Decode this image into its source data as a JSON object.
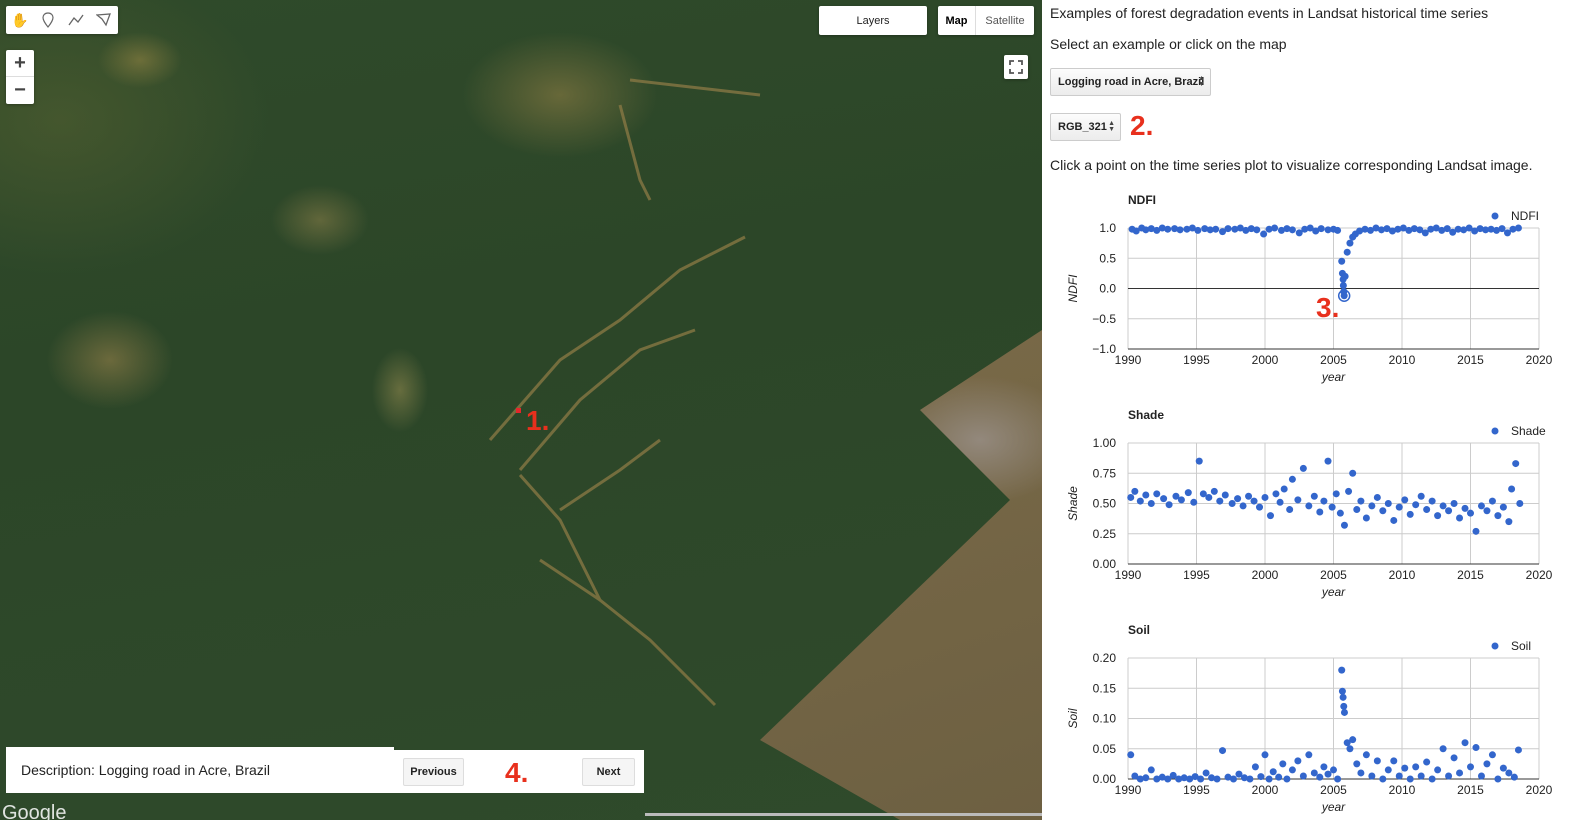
{
  "map": {
    "toolbar_icons": [
      "hand-icon",
      "pin-icon",
      "line-icon",
      "polygon-icon"
    ],
    "zoom_in": "+",
    "zoom_out": "−",
    "layers_label": "Layers",
    "map_type_map": "Map",
    "map_type_satellite": "Satellite",
    "google": "Google",
    "description": "Description: Logging road in Acre, Brazil",
    "previous_label": "Previous",
    "next_label": "Next",
    "annotations": {
      "a1": "1.",
      "a2": "2.",
      "a3": "3.",
      "a4": "4."
    },
    "annotation_color": "#e8301d"
  },
  "panel": {
    "title": "Examples of forest degradation events in Landsat historical time series",
    "select_prompt": "Select an example or click on the map",
    "example_select": "Logging road in Acre, Brazil",
    "band_select": "RGB_321",
    "click_prompt": "Click a point on the time series plot to visualize corresponding Landsat image."
  },
  "chart_data": [
    {
      "type": "scatter",
      "title": "NDFI",
      "xlabel": "year",
      "ylabel": "NDFI",
      "legend": "NDFI",
      "legend_position": "top-right",
      "xlim": [
        1990,
        2020
      ],
      "ylim": [
        -1.0,
        1.0
      ],
      "xticks": [
        1990,
        1995,
        2000,
        2005,
        2010,
        2015,
        2020
      ],
      "yticks": [
        -1.0,
        -0.5,
        0.0,
        0.5,
        1.0
      ],
      "ytick_labels": [
        "−1.0",
        "−0.5",
        "0.0",
        "0.5",
        "1.0"
      ],
      "zero_line": true,
      "color": "#3366cc",
      "points": [
        [
          1990.3,
          0.98
        ],
        [
          1990.6,
          0.95
        ],
        [
          1991.0,
          1.0
        ],
        [
          1991.3,
          0.97
        ],
        [
          1991.7,
          0.99
        ],
        [
          1992.1,
          0.96
        ],
        [
          1992.5,
          1.0
        ],
        [
          1992.9,
          0.98
        ],
        [
          1993.4,
          0.99
        ],
        [
          1993.8,
          0.97
        ],
        [
          1994.3,
          0.98
        ],
        [
          1994.7,
          1.0
        ],
        [
          1995.1,
          0.96
        ],
        [
          1995.6,
          0.99
        ],
        [
          1996.0,
          0.97
        ],
        [
          1996.4,
          0.98
        ],
        [
          1996.9,
          0.94
        ],
        [
          1997.3,
          0.99
        ],
        [
          1997.8,
          0.98
        ],
        [
          1998.2,
          1.0
        ],
        [
          1998.6,
          0.96
        ],
        [
          1999.0,
          0.99
        ],
        [
          1999.4,
          0.97
        ],
        [
          1999.9,
          0.9
        ],
        [
          2000.3,
          0.98
        ],
        [
          2000.7,
          1.0
        ],
        [
          2001.2,
          0.96
        ],
        [
          2001.6,
          0.99
        ],
        [
          2002.0,
          0.97
        ],
        [
          2002.5,
          0.92
        ],
        [
          2002.9,
          0.98
        ],
        [
          2003.3,
          1.0
        ],
        [
          2003.7,
          0.95
        ],
        [
          2004.1,
          0.99
        ],
        [
          2004.6,
          0.97
        ],
        [
          2005.0,
          0.98
        ],
        [
          2005.3,
          0.96
        ],
        [
          2005.6,
          0.45
        ],
        [
          2005.65,
          0.25
        ],
        [
          2005.7,
          0.15
        ],
        [
          2005.72,
          0.05
        ],
        [
          2005.75,
          -0.05
        ],
        [
          2005.78,
          -0.12
        ],
        [
          2005.85,
          0.2
        ],
        [
          2006.0,
          0.6
        ],
        [
          2006.2,
          0.75
        ],
        [
          2006.4,
          0.85
        ],
        [
          2006.6,
          0.9
        ],
        [
          2006.9,
          0.95
        ],
        [
          2007.3,
          0.98
        ],
        [
          2007.7,
          0.96
        ],
        [
          2008.1,
          1.0
        ],
        [
          2008.5,
          0.97
        ],
        [
          2008.9,
          0.99
        ],
        [
          2009.3,
          0.95
        ],
        [
          2009.7,
          0.98
        ],
        [
          2010.1,
          1.0
        ],
        [
          2010.5,
          0.96
        ],
        [
          2010.9,
          0.99
        ],
        [
          2011.3,
          0.97
        ],
        [
          2011.7,
          0.92
        ],
        [
          2012.1,
          0.98
        ],
        [
          2012.5,
          1.0
        ],
        [
          2012.9,
          0.96
        ],
        [
          2013.3,
          0.99
        ],
        [
          2013.7,
          0.93
        ],
        [
          2014.1,
          0.98
        ],
        [
          2014.5,
          0.97
        ],
        [
          2014.9,
          1.0
        ],
        [
          2015.3,
          0.95
        ],
        [
          2015.7,
          0.99
        ],
        [
          2016.1,
          0.97
        ],
        [
          2016.5,
          0.98
        ],
        [
          2016.9,
          0.96
        ],
        [
          2017.3,
          0.99
        ],
        [
          2017.7,
          0.92
        ],
        [
          2018.1,
          0.98
        ],
        [
          2018.5,
          1.0
        ]
      ],
      "selected_point": [
        2005.78,
        -0.12
      ]
    },
    {
      "type": "scatter",
      "title": "Shade",
      "xlabel": "year",
      "ylabel": "Shade",
      "legend": "Shade",
      "legend_position": "top-right",
      "xlim": [
        1990,
        2020
      ],
      "ylim": [
        0.0,
        1.0
      ],
      "xticks": [
        1990,
        1995,
        2000,
        2005,
        2010,
        2015,
        2020
      ],
      "yticks": [
        0.0,
        0.25,
        0.5,
        0.75,
        1.0
      ],
      "ytick_labels": [
        "0.00",
        "0.25",
        "0.50",
        "0.75",
        "1.00"
      ],
      "color": "#3366cc",
      "points": [
        [
          1990.2,
          0.55
        ],
        [
          1990.5,
          0.6
        ],
        [
          1990.9,
          0.52
        ],
        [
          1991.3,
          0.57
        ],
        [
          1991.7,
          0.5
        ],
        [
          1992.1,
          0.58
        ],
        [
          1992.6,
          0.54
        ],
        [
          1993.0,
          0.49
        ],
        [
          1993.5,
          0.56
        ],
        [
          1993.9,
          0.53
        ],
        [
          1994.4,
          0.59
        ],
        [
          1994.8,
          0.51
        ],
        [
          1995.2,
          0.85
        ],
        [
          1995.5,
          0.58
        ],
        [
          1995.9,
          0.55
        ],
        [
          1996.3,
          0.6
        ],
        [
          1996.7,
          0.52
        ],
        [
          1997.1,
          0.57
        ],
        [
          1997.6,
          0.5
        ],
        [
          1998.0,
          0.54
        ],
        [
          1998.4,
          0.48
        ],
        [
          1998.8,
          0.56
        ],
        [
          1999.2,
          0.52
        ],
        [
          1999.6,
          0.47
        ],
        [
          2000.0,
          0.55
        ],
        [
          2000.4,
          0.4
        ],
        [
          2000.8,
          0.58
        ],
        [
          2001.1,
          0.51
        ],
        [
          2001.4,
          0.62
        ],
        [
          2001.8,
          0.45
        ],
        [
          2002.0,
          0.7
        ],
        [
          2002.4,
          0.53
        ],
        [
          2002.8,
          0.79
        ],
        [
          2003.2,
          0.48
        ],
        [
          2003.6,
          0.56
        ],
        [
          2004.0,
          0.43
        ],
        [
          2004.3,
          0.52
        ],
        [
          2004.6,
          0.85
        ],
        [
          2004.9,
          0.47
        ],
        [
          2005.2,
          0.58
        ],
        [
          2005.5,
          0.42
        ],
        [
          2005.8,
          0.32
        ],
        [
          2006.1,
          0.6
        ],
        [
          2006.4,
          0.75
        ],
        [
          2006.7,
          0.45
        ],
        [
          2007.0,
          0.52
        ],
        [
          2007.4,
          0.38
        ],
        [
          2007.8,
          0.48
        ],
        [
          2008.2,
          0.55
        ],
        [
          2008.6,
          0.44
        ],
        [
          2009.0,
          0.5
        ],
        [
          2009.4,
          0.36
        ],
        [
          2009.8,
          0.47
        ],
        [
          2010.2,
          0.53
        ],
        [
          2010.6,
          0.41
        ],
        [
          2011.0,
          0.49
        ],
        [
          2011.4,
          0.56
        ],
        [
          2011.8,
          0.45
        ],
        [
          2012.2,
          0.52
        ],
        [
          2012.6,
          0.4
        ],
        [
          2013.0,
          0.48
        ],
        [
          2013.4,
          0.44
        ],
        [
          2013.8,
          0.5
        ],
        [
          2014.2,
          0.38
        ],
        [
          2014.6,
          0.46
        ],
        [
          2015.0,
          0.42
        ],
        [
          2015.4,
          0.27
        ],
        [
          2015.8,
          0.48
        ],
        [
          2016.2,
          0.44
        ],
        [
          2016.6,
          0.52
        ],
        [
          2017.0,
          0.4
        ],
        [
          2017.4,
          0.47
        ],
        [
          2017.8,
          0.35
        ],
        [
          2018.0,
          0.62
        ],
        [
          2018.3,
          0.83
        ],
        [
          2018.6,
          0.5
        ]
      ]
    },
    {
      "type": "scatter",
      "title": "Soil",
      "xlabel": "year",
      "ylabel": "Soil",
      "legend": "Soil",
      "legend_position": "top-right",
      "xlim": [
        1990,
        2020
      ],
      "ylim": [
        0.0,
        0.2
      ],
      "xticks": [
        1990,
        1995,
        2000,
        2005,
        2010,
        2015,
        2020
      ],
      "yticks": [
        0.0,
        0.05,
        0.1,
        0.15,
        0.2
      ],
      "ytick_labels": [
        "0.00",
        "0.05",
        "0.10",
        "0.15",
        "0.20"
      ],
      "color": "#3366cc",
      "points": [
        [
          1990.2,
          0.04
        ],
        [
          1990.5,
          0.005
        ],
        [
          1990.9,
          0.0
        ],
        [
          1991.3,
          0.002
        ],
        [
          1991.7,
          0.015
        ],
        [
          1992.1,
          0.0
        ],
        [
          1992.5,
          0.003
        ],
        [
          1992.9,
          0.0
        ],
        [
          1993.3,
          0.006
        ],
        [
          1993.7,
          0.0
        ],
        [
          1994.1,
          0.002
        ],
        [
          1994.5,
          0.0
        ],
        [
          1994.9,
          0.004
        ],
        [
          1995.3,
          0.0
        ],
        [
          1995.7,
          0.01
        ],
        [
          1996.1,
          0.002
        ],
        [
          1996.5,
          0.0
        ],
        [
          1996.9,
          0.047
        ],
        [
          1997.3,
          0.003
        ],
        [
          1997.7,
          0.0
        ],
        [
          1998.1,
          0.008
        ],
        [
          1998.5,
          0.002
        ],
        [
          1998.9,
          0.0
        ],
        [
          1999.3,
          0.02
        ],
        [
          1999.7,
          0.004
        ],
        [
          2000.0,
          0.04
        ],
        [
          2000.3,
          0.0
        ],
        [
          2000.6,
          0.012
        ],
        [
          2001.0,
          0.003
        ],
        [
          2001.3,
          0.025
        ],
        [
          2001.6,
          0.0
        ],
        [
          2002.0,
          0.015
        ],
        [
          2002.4,
          0.03
        ],
        [
          2002.8,
          0.005
        ],
        [
          2003.2,
          0.04
        ],
        [
          2003.6,
          0.01
        ],
        [
          2004.0,
          0.003
        ],
        [
          2004.3,
          0.02
        ],
        [
          2004.6,
          0.008
        ],
        [
          2005.0,
          0.015
        ],
        [
          2005.3,
          0.0
        ],
        [
          2005.6,
          0.18
        ],
        [
          2005.65,
          0.145
        ],
        [
          2005.7,
          0.135
        ],
        [
          2005.75,
          0.12
        ],
        [
          2005.8,
          0.11
        ],
        [
          2006.0,
          0.06
        ],
        [
          2006.2,
          0.05
        ],
        [
          2006.4,
          0.065
        ],
        [
          2006.7,
          0.025
        ],
        [
          2007.0,
          0.01
        ],
        [
          2007.4,
          0.04
        ],
        [
          2007.8,
          0.005
        ],
        [
          2008.2,
          0.03
        ],
        [
          2008.6,
          0.0
        ],
        [
          2009.0,
          0.015
        ],
        [
          2009.4,
          0.03
        ],
        [
          2009.8,
          0.005
        ],
        [
          2010.2,
          0.018
        ],
        [
          2010.6,
          0.0
        ],
        [
          2011.0,
          0.02
        ],
        [
          2011.4,
          0.005
        ],
        [
          2011.8,
          0.028
        ],
        [
          2012.2,
          0.0
        ],
        [
          2012.6,
          0.015
        ],
        [
          2013.0,
          0.05
        ],
        [
          2013.4,
          0.005
        ],
        [
          2013.8,
          0.035
        ],
        [
          2014.2,
          0.01
        ],
        [
          2014.6,
          0.06
        ],
        [
          2015.0,
          0.02
        ],
        [
          2015.4,
          0.052
        ],
        [
          2015.8,
          0.005
        ],
        [
          2016.2,
          0.025
        ],
        [
          2016.6,
          0.04
        ],
        [
          2017.0,
          0.0
        ],
        [
          2017.4,
          0.018
        ],
        [
          2017.8,
          0.01
        ],
        [
          2018.2,
          0.003
        ],
        [
          2018.5,
          0.048
        ]
      ]
    }
  ]
}
